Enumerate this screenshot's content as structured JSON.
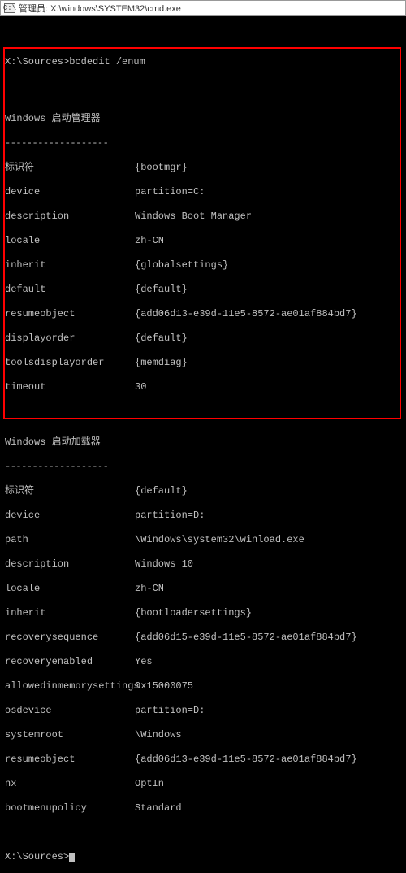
{
  "window": {
    "icon_label": "C:\\",
    "title": "管理员: X:\\windows\\SYSTEM32\\cmd.exe"
  },
  "prompt1": "X:\\Sources>bcdedit /enum",
  "section1": {
    "title": "Windows 启动管理器",
    "dashes": "-------------------",
    "rows": {
      "r1k": "标识符",
      "r1v": "{bootmgr}",
      "r2k": "device",
      "r2v": "partition=C:",
      "r3k": "description",
      "r3v": "Windows Boot Manager",
      "r4k": "locale",
      "r4v": "zh-CN",
      "r5k": "inherit",
      "r5v": "{globalsettings}",
      "r6k": "default",
      "r6v": "{default}",
      "r7k": "resumeobject",
      "r7v": "{add06d13-e39d-11e5-8572-ae01af884bd7}",
      "r8k": "displayorder",
      "r8v": "{default}",
      "r9k": "toolsdisplayorder",
      "r9v": "{memdiag}",
      "r10k": "timeout",
      "r10v": "30"
    }
  },
  "section2": {
    "title": "Windows 启动加载器",
    "dashes": "-------------------",
    "rows": {
      "r1k": "标识符",
      "r1v": "{default}",
      "r2k": "device",
      "r2v": "partition=D:",
      "r3k": "path",
      "r3v": "\\Windows\\system32\\winload.exe",
      "r4k": "description",
      "r4v": "Windows 10",
      "r5k": "locale",
      "r5v": "zh-CN",
      "r6k": "inherit",
      "r6v": "{bootloadersettings}",
      "r7k": "recoverysequence",
      "r7v": "{add06d15-e39d-11e5-8572-ae01af884bd7}",
      "r8k": "recoveryenabled",
      "r8v": "Yes",
      "r9k": "allowedinmemorysettings",
      "r9v": "0x15000075",
      "r10k": "osdevice",
      "r10v": "partition=D:",
      "r11k": "systemroot",
      "r11v": "\\Windows",
      "r12k": "resumeobject",
      "r12v": "{add06d13-e39d-11e5-8572-ae01af884bd7}",
      "r13k": "nx",
      "r13v": "OptIn",
      "r14k": "bootmenupolicy",
      "r14v": "Standard"
    }
  },
  "prompt2": "X:\\Sources>"
}
